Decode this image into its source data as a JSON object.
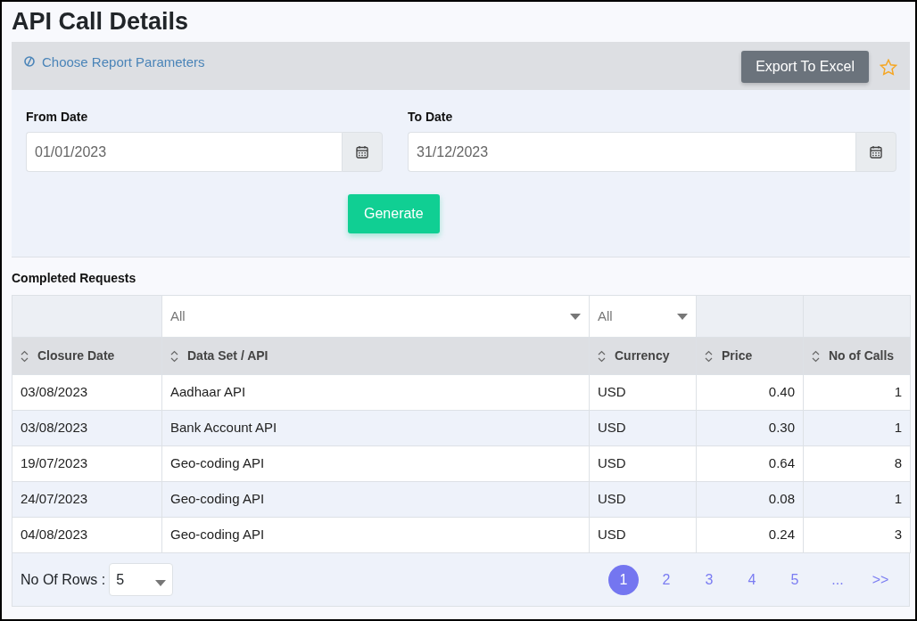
{
  "title": "API Call Details",
  "parameters": {
    "heading": "Choose Report Parameters",
    "export_button": "Export To Excel",
    "favorite": false,
    "from_date": {
      "label": "From Date",
      "value": "01/01/2023"
    },
    "to_date": {
      "label": "To Date",
      "value": "31/12/2023"
    },
    "generate_button": "Generate"
  },
  "table": {
    "title": "Completed Requests",
    "columns": [
      {
        "label": "Closure Date",
        "kind": "text"
      },
      {
        "label": "Data Set / API",
        "kind": "text",
        "filter": "All"
      },
      {
        "label": "Currency",
        "kind": "text",
        "filter": "All"
      },
      {
        "label": "Price",
        "kind": "number"
      },
      {
        "label": "No of Calls",
        "kind": "number"
      }
    ],
    "rows": [
      [
        "03/08/2023",
        "Aadhaar API",
        "USD",
        "0.40",
        "1"
      ],
      [
        "03/08/2023",
        "Bank Account API",
        "USD",
        "0.30",
        "1"
      ],
      [
        "19/07/2023",
        "Geo-coding API",
        "USD",
        "0.64",
        "8"
      ],
      [
        "24/07/2023",
        "Geo-coding API",
        "USD",
        "0.08",
        "1"
      ],
      [
        "04/08/2023",
        "Geo-coding API",
        "USD",
        "0.24",
        "3"
      ]
    ]
  },
  "footer": {
    "rows_label": "No Of Rows :",
    "rows_value": "5",
    "pages": [
      {
        "label": "1",
        "selected": true
      },
      {
        "label": "2",
        "selected": false
      },
      {
        "label": "3",
        "selected": false
      },
      {
        "label": "4",
        "selected": false
      },
      {
        "label": "5",
        "selected": false
      },
      {
        "label": "...",
        "selected": false
      },
      {
        "label": ">>",
        "selected": false
      }
    ]
  }
}
